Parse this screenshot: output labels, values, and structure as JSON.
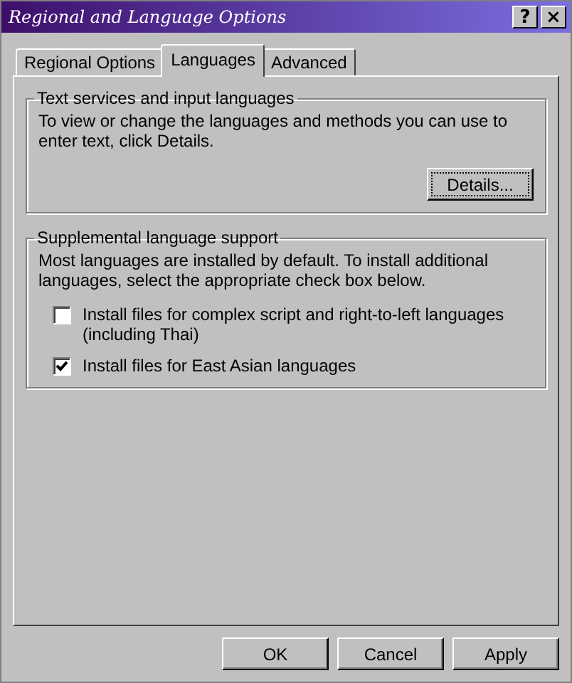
{
  "window": {
    "title": "Regional and Language Options",
    "controls": [
      "?",
      "×"
    ]
  },
  "tabs": [
    {
      "label": "Regional Options",
      "selected": false
    },
    {
      "label": "Languages",
      "selected": true
    },
    {
      "label": "Advanced",
      "selected": false
    }
  ],
  "groups": [
    {
      "title": "Text services and input languages",
      "description": "To view or change the languages and methods you can use to enter text, click Details.",
      "button": "Details..."
    },
    {
      "title": "Supplemental language support",
      "description": "Most languages are installed by default. To install additional languages, select the appropriate check box below.",
      "options": [
        {
          "label": "Install files for complex script and right-to-left languages (including Thai)",
          "checked": false
        },
        {
          "label": "Install files for East Asian languages",
          "checked": true
        }
      ]
    }
  ],
  "buttons": [
    "OK",
    "Cancel",
    "Apply"
  ]
}
